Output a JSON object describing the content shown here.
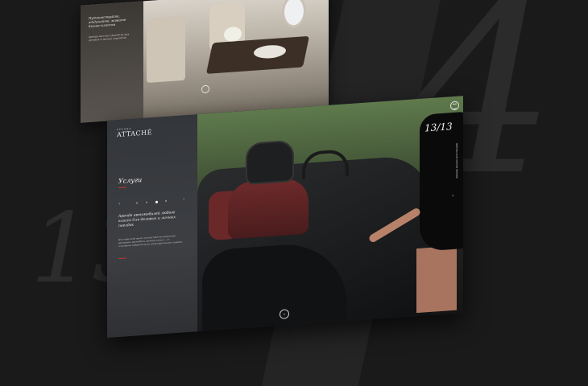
{
  "background": {
    "big_digit": "4",
    "big_number": "13"
  },
  "top_screen": {
    "headline": "Путешествуйте, отдыхайте, живите бизнес-классом",
    "subtext": "Аренда частных самолётов для деловых и личных перелётов"
  },
  "main_screen": {
    "logo_small": "АРЕНДА",
    "logo": "ATTACHÉ",
    "section_title": "Услуги",
    "description_title": "Аренда автомобилей любого класса для деловых и личных поездок",
    "description_body": "Для любителей ярких путешествий мы предлагаем арендовать автомобиль премиум-класса — от спортивных кабриолетов до представительских седанов.",
    "counter": "13/13",
    "vertical_label": "Аренда машин для поездок",
    "scroll_icon": "chevron-down-icon",
    "menu_icon": "menu-icon"
  },
  "colors": {
    "accent": "#c0392b",
    "background": "#1a1a1a"
  }
}
